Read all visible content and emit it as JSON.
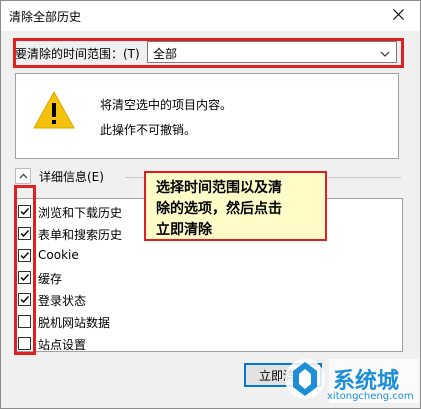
{
  "window": {
    "title": "清除全部历史"
  },
  "range": {
    "label": "要清除的时间范围：(T)",
    "selected": "全部"
  },
  "warning": {
    "line1": "将清空选中的项目内容。",
    "line2": "此操作不可撤销。"
  },
  "details": {
    "label": "详细信息(E)"
  },
  "items": [
    {
      "label": "浏览和下载历史",
      "checked": true
    },
    {
      "label": "表单和搜索历史",
      "checked": true
    },
    {
      "label": "Cookie",
      "checked": true
    },
    {
      "label": "缓存",
      "checked": true
    },
    {
      "label": "登录状态",
      "checked": true
    },
    {
      "label": "脱机网站数据",
      "checked": false
    },
    {
      "label": "站点设置",
      "checked": false
    }
  ],
  "callout": {
    "line1": "选择时间范围以及清",
    "line2": "除的选项，然后点击",
    "line3": "立即清除"
  },
  "buttons": {
    "clear_now": "立即清除"
  },
  "watermark": {
    "brand": "系统城",
    "url": "xitongcheng.com"
  },
  "colors": {
    "highlight_red": "#e02020",
    "callout_bg": "#fffcc8",
    "warning_yellow": "#f4c20d"
  }
}
